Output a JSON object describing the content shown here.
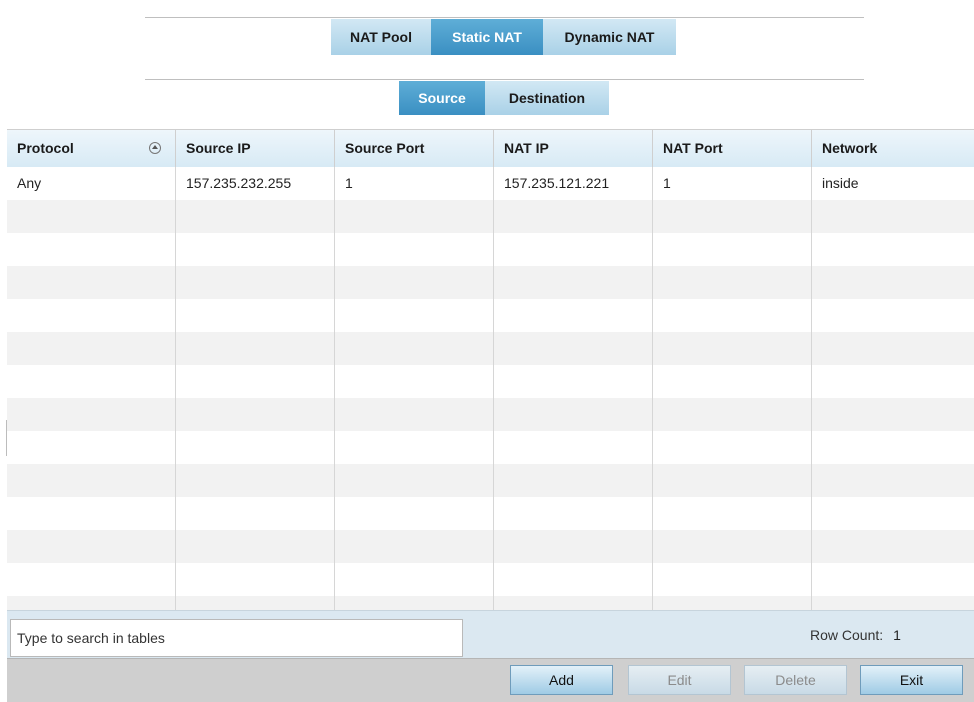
{
  "nat_tabs": [
    {
      "label": "NAT Pool",
      "active": false
    },
    {
      "label": "Static NAT",
      "active": true
    },
    {
      "label": "Dynamic NAT",
      "active": false
    }
  ],
  "sub_tabs": [
    {
      "label": "Source",
      "active": true
    },
    {
      "label": "Destination",
      "active": false
    }
  ],
  "table": {
    "headers": [
      "Protocol",
      "Source IP",
      "Source Port",
      "NAT IP",
      "NAT Port",
      "Network"
    ],
    "sort_icon": "sort-ascending-icon",
    "rows": [
      [
        "Any",
        "157.235.232.255",
        "1",
        "157.235.121.221",
        "1",
        "inside"
      ]
    ]
  },
  "search": {
    "placeholder": "Type to search in tables",
    "value": ""
  },
  "row_count": {
    "label": "Row Count:",
    "value": "1"
  },
  "buttons": {
    "add": {
      "label": "Add",
      "enabled": true
    },
    "edit": {
      "label": "Edit",
      "enabled": false
    },
    "delete": {
      "label": "Delete",
      "enabled": false
    },
    "exit": {
      "label": "Exit",
      "enabled": true
    }
  },
  "colors": {
    "tab_active": "#3a8fc2",
    "tab_inactive": "#a9d1e7",
    "header_bg": "#d7eaf5",
    "search_bar_bg": "#dbe8f1",
    "button_bar_bg": "#cfcfcf"
  }
}
